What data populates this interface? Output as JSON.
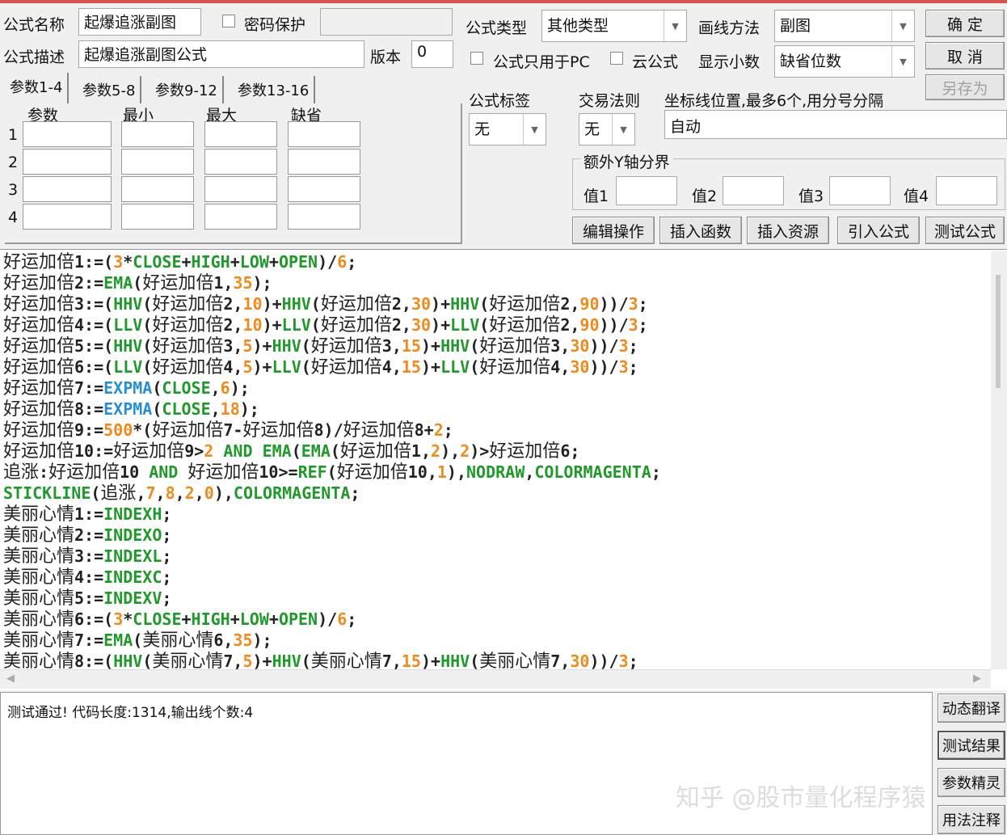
{
  "header": {
    "name_label": "公式名称",
    "name_value": "起爆追涨副图",
    "password_label": "密码保护",
    "password_value": "",
    "desc_label": "公式描述",
    "desc_value": "起爆追涨副图公式",
    "version_label": "版本",
    "version_value": "0",
    "type_label": "公式类型",
    "type_value": "其他类型",
    "draw_label": "画线方法",
    "draw_value": "副图",
    "pc_only_label": "公式只用于PC",
    "cloud_label": "云公式",
    "decimal_label": "显示小数",
    "decimal_value": "缺省位数",
    "ok": "确  定",
    "cancel": "取  消",
    "save_as": "另存为",
    "tag_label": "公式标签",
    "tag_value": "无",
    "rule_label": "交易法则",
    "rule_value": "无",
    "axis_label": "坐标线位置,最多6个,用分号分隔",
    "axis_value": "自动",
    "yaxis_group": "额外Y轴分界",
    "values": [
      "值1",
      "值2",
      "值3",
      "值4"
    ]
  },
  "tabs": [
    "参数1-4",
    "参数5-8",
    "参数9-12",
    "参数13-16"
  ],
  "param_headers": [
    "参数",
    "最小",
    "最大",
    "缺省"
  ],
  "param_rows": [
    "1",
    "2",
    "3",
    "4"
  ],
  "actions": [
    "编辑操作",
    "插入函数",
    "插入资源",
    "引入公式",
    "测试公式"
  ],
  "code": [
    [
      [
        "好运加倍",
        "t"
      ],
      [
        "1:=(",
        "p"
      ],
      [
        "3",
        "n"
      ],
      [
        "*",
        "p"
      ],
      [
        "CLOSE",
        "f"
      ],
      [
        "+",
        "p"
      ],
      [
        "HIGH",
        "f"
      ],
      [
        "+",
        "p"
      ],
      [
        "LOW",
        "f"
      ],
      [
        "+",
        "p"
      ],
      [
        "OPEN",
        "f"
      ],
      [
        ")/",
        "p"
      ],
      [
        "6",
        "n"
      ],
      [
        ";",
        "p"
      ]
    ],
    [
      [
        "好运加倍",
        "t"
      ],
      [
        "2:=",
        "p"
      ],
      [
        "EMA",
        "f"
      ],
      [
        "(",
        "p"
      ],
      [
        "好运加倍",
        "t"
      ],
      [
        "1,",
        "p"
      ],
      [
        "35",
        "n"
      ],
      [
        ");",
        "p"
      ]
    ],
    [
      [
        "好运加倍",
        "t"
      ],
      [
        "3:=(",
        "p"
      ],
      [
        "HHV",
        "f"
      ],
      [
        "(",
        "p"
      ],
      [
        "好运加倍",
        "t"
      ],
      [
        "2,",
        "p"
      ],
      [
        "10",
        "n"
      ],
      [
        ")+",
        "p"
      ],
      [
        "HHV",
        "f"
      ],
      [
        "(",
        "p"
      ],
      [
        "好运加倍",
        "t"
      ],
      [
        "2,",
        "p"
      ],
      [
        "30",
        "n"
      ],
      [
        ")+",
        "p"
      ],
      [
        "HHV",
        "f"
      ],
      [
        "(",
        "p"
      ],
      [
        "好运加倍",
        "t"
      ],
      [
        "2,",
        "p"
      ],
      [
        "90",
        "n"
      ],
      [
        "))/",
        "p"
      ],
      [
        "3",
        "n"
      ],
      [
        ";",
        "p"
      ]
    ],
    [
      [
        "好运加倍",
        "t"
      ],
      [
        "4:=(",
        "p"
      ],
      [
        "LLV",
        "f"
      ],
      [
        "(",
        "p"
      ],
      [
        "好运加倍",
        "t"
      ],
      [
        "2,",
        "p"
      ],
      [
        "10",
        "n"
      ],
      [
        ")+",
        "p"
      ],
      [
        "LLV",
        "f"
      ],
      [
        "(",
        "p"
      ],
      [
        "好运加倍",
        "t"
      ],
      [
        "2,",
        "p"
      ],
      [
        "30",
        "n"
      ],
      [
        ")+",
        "p"
      ],
      [
        "LLV",
        "f"
      ],
      [
        "(",
        "p"
      ],
      [
        "好运加倍",
        "t"
      ],
      [
        "2,",
        "p"
      ],
      [
        "90",
        "n"
      ],
      [
        "))/",
        "p"
      ],
      [
        "3",
        "n"
      ],
      [
        ";",
        "p"
      ]
    ],
    [
      [
        "好运加倍",
        "t"
      ],
      [
        "5:=(",
        "p"
      ],
      [
        "HHV",
        "f"
      ],
      [
        "(",
        "p"
      ],
      [
        "好运加倍",
        "t"
      ],
      [
        "3,",
        "p"
      ],
      [
        "5",
        "n"
      ],
      [
        ")+",
        "p"
      ],
      [
        "HHV",
        "f"
      ],
      [
        "(",
        "p"
      ],
      [
        "好运加倍",
        "t"
      ],
      [
        "3,",
        "p"
      ],
      [
        "15",
        "n"
      ],
      [
        ")+",
        "p"
      ],
      [
        "HHV",
        "f"
      ],
      [
        "(",
        "p"
      ],
      [
        "好运加倍",
        "t"
      ],
      [
        "3,",
        "p"
      ],
      [
        "30",
        "n"
      ],
      [
        "))/",
        "p"
      ],
      [
        "3",
        "n"
      ],
      [
        ";",
        "p"
      ]
    ],
    [
      [
        "好运加倍",
        "t"
      ],
      [
        "6:=(",
        "p"
      ],
      [
        "LLV",
        "f"
      ],
      [
        "(",
        "p"
      ],
      [
        "好运加倍",
        "t"
      ],
      [
        "4,",
        "p"
      ],
      [
        "5",
        "n"
      ],
      [
        ")+",
        "p"
      ],
      [
        "LLV",
        "f"
      ],
      [
        "(",
        "p"
      ],
      [
        "好运加倍",
        "t"
      ],
      [
        "4,",
        "p"
      ],
      [
        "15",
        "n"
      ],
      [
        ")+",
        "p"
      ],
      [
        "LLV",
        "f"
      ],
      [
        "(",
        "p"
      ],
      [
        "好运加倍",
        "t"
      ],
      [
        "4,",
        "p"
      ],
      [
        "30",
        "n"
      ],
      [
        "))/",
        "p"
      ],
      [
        "3",
        "n"
      ],
      [
        ";",
        "p"
      ]
    ],
    [
      [
        "好运加倍",
        "t"
      ],
      [
        "7:=",
        "p"
      ],
      [
        "EXPMA",
        "b"
      ],
      [
        "(",
        "p"
      ],
      [
        "CLOSE",
        "f"
      ],
      [
        ",",
        "p"
      ],
      [
        "6",
        "n"
      ],
      [
        ");",
        "p"
      ]
    ],
    [
      [
        "好运加倍",
        "t"
      ],
      [
        "8:=",
        "p"
      ],
      [
        "EXPMA",
        "b"
      ],
      [
        "(",
        "p"
      ],
      [
        "CLOSE",
        "f"
      ],
      [
        ",",
        "p"
      ],
      [
        "18",
        "n"
      ],
      [
        ");",
        "p"
      ]
    ],
    [
      [
        "好运加倍",
        "t"
      ],
      [
        "9:=",
        "p"
      ],
      [
        "500",
        "n"
      ],
      [
        "*(",
        "p"
      ],
      [
        "好运加倍",
        "t"
      ],
      [
        "7-",
        "p"
      ],
      [
        "好运加倍",
        "t"
      ],
      [
        "8)/",
        "p"
      ],
      [
        "好运加倍",
        "t"
      ],
      [
        "8+",
        "p"
      ],
      [
        "2",
        "n"
      ],
      [
        ";",
        "p"
      ]
    ],
    [
      [
        "好运加倍",
        "t"
      ],
      [
        "10:=",
        "p"
      ],
      [
        "好运加倍",
        "t"
      ],
      [
        "9>",
        "p"
      ],
      [
        "2",
        "n"
      ],
      [
        " ",
        "p"
      ],
      [
        "AND",
        "f"
      ],
      [
        " ",
        "p"
      ],
      [
        "EMA",
        "f"
      ],
      [
        "(",
        "p"
      ],
      [
        "EMA",
        "f"
      ],
      [
        "(",
        "p"
      ],
      [
        "好运加倍",
        "t"
      ],
      [
        "1,",
        "p"
      ],
      [
        "2",
        "n"
      ],
      [
        "),",
        "p"
      ],
      [
        "2",
        "n"
      ],
      [
        ")>",
        "p"
      ],
      [
        "好运加倍",
        "t"
      ],
      [
        "6;",
        "p"
      ]
    ],
    [
      [
        "追涨",
        "t"
      ],
      [
        ":",
        "p"
      ],
      [
        "好运加倍",
        "t"
      ],
      [
        "10 ",
        "p"
      ],
      [
        "AND",
        "f"
      ],
      [
        " ",
        "p"
      ],
      [
        "好运加倍",
        "t"
      ],
      [
        "10>=",
        "p"
      ],
      [
        "REF",
        "f"
      ],
      [
        "(",
        "p"
      ],
      [
        "好运加倍",
        "t"
      ],
      [
        "10,",
        "p"
      ],
      [
        "1",
        "n"
      ],
      [
        "),",
        "p"
      ],
      [
        "NODRAW",
        "f"
      ],
      [
        ",",
        "p"
      ],
      [
        "COLORMAGENTA",
        "f"
      ],
      [
        ";",
        "p"
      ]
    ],
    [
      [
        "STICKLINE",
        "f"
      ],
      [
        "(",
        "p"
      ],
      [
        "追涨",
        "t"
      ],
      [
        ",",
        "p"
      ],
      [
        "7",
        "n"
      ],
      [
        ",",
        "p"
      ],
      [
        "8",
        "n"
      ],
      [
        ",",
        "p"
      ],
      [
        "2",
        "n"
      ],
      [
        ",",
        "p"
      ],
      [
        "0",
        "n"
      ],
      [
        "),",
        "p"
      ],
      [
        "COLORMAGENTA",
        "f"
      ],
      [
        ";",
        "p"
      ]
    ],
    [
      [
        "美丽心情",
        "t"
      ],
      [
        "1:=",
        "p"
      ],
      [
        "INDEXH",
        "f"
      ],
      [
        ";",
        "p"
      ]
    ],
    [
      [
        "美丽心情",
        "t"
      ],
      [
        "2:=",
        "p"
      ],
      [
        "INDEXO",
        "f"
      ],
      [
        ";",
        "p"
      ]
    ],
    [
      [
        "美丽心情",
        "t"
      ],
      [
        "3:=",
        "p"
      ],
      [
        "INDEXL",
        "f"
      ],
      [
        ";",
        "p"
      ]
    ],
    [
      [
        "美丽心情",
        "t"
      ],
      [
        "4:=",
        "p"
      ],
      [
        "INDEXC",
        "f"
      ],
      [
        ";",
        "p"
      ]
    ],
    [
      [
        "美丽心情",
        "t"
      ],
      [
        "5:=",
        "p"
      ],
      [
        "INDEXV",
        "f"
      ],
      [
        ";",
        "p"
      ]
    ],
    [
      [
        "美丽心情",
        "t"
      ],
      [
        "6:=(",
        "p"
      ],
      [
        "3",
        "n"
      ],
      [
        "*",
        "p"
      ],
      [
        "CLOSE",
        "f"
      ],
      [
        "+",
        "p"
      ],
      [
        "HIGH",
        "f"
      ],
      [
        "+",
        "p"
      ],
      [
        "LOW",
        "f"
      ],
      [
        "+",
        "p"
      ],
      [
        "OPEN",
        "f"
      ],
      [
        ")/",
        "p"
      ],
      [
        "6",
        "n"
      ],
      [
        ";",
        "p"
      ]
    ],
    [
      [
        "美丽心情",
        "t"
      ],
      [
        "7:=",
        "p"
      ],
      [
        "EMA",
        "f"
      ],
      [
        "(",
        "p"
      ],
      [
        "美丽心情",
        "t"
      ],
      [
        "6,",
        "p"
      ],
      [
        "35",
        "n"
      ],
      [
        ");",
        "p"
      ]
    ],
    [
      [
        "美丽心情",
        "t"
      ],
      [
        "8:=(",
        "p"
      ],
      [
        "HHV",
        "f"
      ],
      [
        "(",
        "p"
      ],
      [
        "美丽心情",
        "t"
      ],
      [
        "7,",
        "p"
      ],
      [
        "5",
        "n"
      ],
      [
        ")+",
        "p"
      ],
      [
        "HHV",
        "f"
      ],
      [
        "(",
        "p"
      ],
      [
        "美丽心情",
        "t"
      ],
      [
        "7,",
        "p"
      ],
      [
        "15",
        "n"
      ],
      [
        ")+",
        "p"
      ],
      [
        "HHV",
        "f"
      ],
      [
        "(",
        "p"
      ],
      [
        "美丽心情",
        "t"
      ],
      [
        "7,",
        "p"
      ],
      [
        "30",
        "n"
      ],
      [
        "))/",
        "p"
      ],
      [
        "3",
        "n"
      ],
      [
        ";",
        "p"
      ]
    ]
  ],
  "status": "测试通过! 代码长度:1314,输出线个数:4",
  "side_buttons": [
    "动态翻译",
    "测试结果",
    "参数精灵",
    "用法注释"
  ],
  "watermark": "知乎 @股市量化程序猿"
}
